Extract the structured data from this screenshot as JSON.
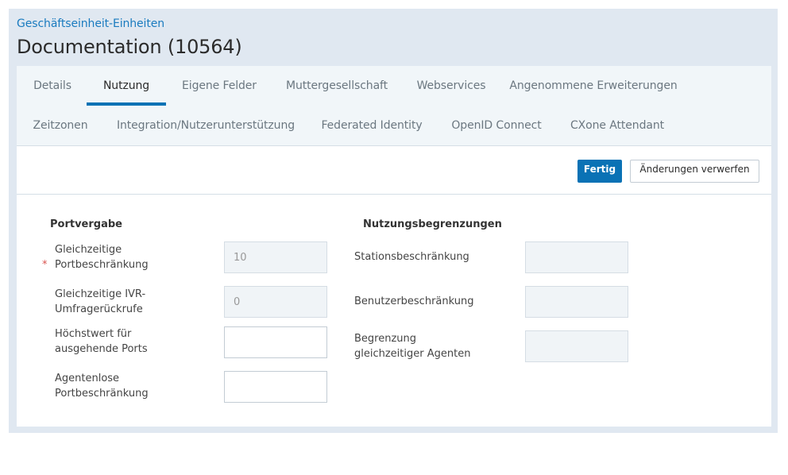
{
  "header": {
    "breadcrumb": "Geschäftseinheit-Einheiten",
    "title": "Documentation (10564)"
  },
  "tabs": [
    {
      "label": "Details",
      "active": false
    },
    {
      "label": "Nutzung",
      "active": true
    },
    {
      "label": "Eigene Felder",
      "active": false
    },
    {
      "label": "Muttergesellschaft",
      "active": false
    },
    {
      "label": "Webservices",
      "active": false
    },
    {
      "label": "Angenommene Erweiterungen",
      "active": false
    },
    {
      "label": "Zeitzonen",
      "active": false
    },
    {
      "label": "Integration/Nutzerunterstützung",
      "active": false
    },
    {
      "label": "Federated Identity",
      "active": false
    },
    {
      "label": "OpenID Connect",
      "active": false
    },
    {
      "label": "CXone Attendant",
      "active": false
    }
  ],
  "actions": {
    "done_label": "Fertig",
    "discard_label": "Änderungen verwerfen"
  },
  "port_allocation": {
    "title": "Portvergabe",
    "fields": [
      {
        "label_line1": "Gleichzeitige",
        "label_line2": "Portbeschränkung",
        "value": "10",
        "required": true,
        "disabled": true
      },
      {
        "label_line1": "Gleichzeitige IVR-",
        "label_line2": "Umfragerückrufe",
        "value": "0",
        "required": false,
        "disabled": true
      },
      {
        "label_line1": "Höchstwert für",
        "label_line2": "ausgehende Ports",
        "value": "",
        "required": false,
        "disabled": false
      },
      {
        "label_line1": "Agentenlose",
        "label_line2": "Portbeschränkung",
        "value": "",
        "required": false,
        "disabled": false
      }
    ],
    "required_marker": "*"
  },
  "usage_limits": {
    "title": "Nutzungsbegrenzungen",
    "fields": [
      {
        "label_line1": "Stationsbeschränkung",
        "label_line2": "",
        "value": "",
        "disabled": true
      },
      {
        "label_line1": "Benutzerbeschränkung",
        "label_line2": "",
        "value": "",
        "disabled": true
      },
      {
        "label_line1": "Begrenzung",
        "label_line2": "gleichzeitiger Agenten",
        "value": "",
        "disabled": true
      }
    ]
  },
  "colors": {
    "accent": "#0a72b5",
    "link": "#1a7bbf",
    "required": "#d9534f",
    "frame_bg": "#e0e8f1",
    "tabs_bg": "#f1f6f9"
  }
}
